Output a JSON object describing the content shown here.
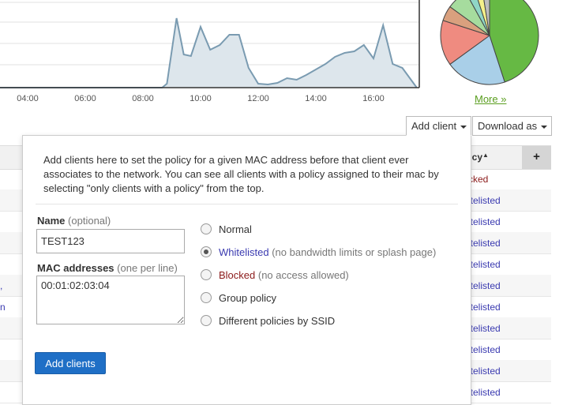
{
  "usage_chart": {
    "x_ticks": [
      "04:00",
      "06:00",
      "08:00",
      "10:00",
      "12:00",
      "14:00",
      "16:00"
    ],
    "series": [
      {
        "x": "00:00",
        "y": 0
      },
      {
        "x": "08:40",
        "y": 0
      },
      {
        "x": "08:50",
        "y": 0.05
      },
      {
        "x": "09:10",
        "y": 0.88
      },
      {
        "x": "09:25",
        "y": 0.42
      },
      {
        "x": "09:40",
        "y": 0.4
      },
      {
        "x": "10:00",
        "y": 0.77
      },
      {
        "x": "10:20",
        "y": 0.48
      },
      {
        "x": "10:40",
        "y": 0.54
      },
      {
        "x": "11:00",
        "y": 0.67
      },
      {
        "x": "11:20",
        "y": 0.67
      },
      {
        "x": "11:40",
        "y": 0.25
      },
      {
        "x": "12:00",
        "y": 0.05
      },
      {
        "x": "12:20",
        "y": 0.04
      },
      {
        "x": "12:40",
        "y": 0.06
      },
      {
        "x": "13:00",
        "y": 0.12
      },
      {
        "x": "13:20",
        "y": 0.1
      },
      {
        "x": "13:40",
        "y": 0.16
      },
      {
        "x": "14:00",
        "y": 0.23
      },
      {
        "x": "14:20",
        "y": 0.3
      },
      {
        "x": "14:40",
        "y": 0.39
      },
      {
        "x": "15:00",
        "y": 0.44
      },
      {
        "x": "15:20",
        "y": 0.46
      },
      {
        "x": "15:40",
        "y": 0.54
      },
      {
        "x": "16:00",
        "y": 0.37
      },
      {
        "x": "16:20",
        "y": 0.79
      },
      {
        "x": "16:40",
        "y": 0.3
      },
      {
        "x": "17:00",
        "y": 0.25
      },
      {
        "x": "17:30",
        "y": 0
      }
    ]
  },
  "pie": {
    "more_label": "More »",
    "slices": [
      {
        "value": 0.45,
        "color": "#66b944"
      },
      {
        "value": 0.2,
        "color": "#a9cfe8"
      },
      {
        "value": 0.15,
        "color": "#ef8b80"
      },
      {
        "value": 0.05,
        "color": "#d9a07e"
      },
      {
        "value": 0.07,
        "color": "#a6dc9e"
      },
      {
        "value": 0.03,
        "color": "#8fd6c6"
      },
      {
        "value": 0.025,
        "color": "#f5f08a"
      },
      {
        "value": 0.025,
        "color": "#bdbdbd"
      }
    ]
  },
  "toolbar": {
    "add_client_label": "Add client",
    "download_label": "Download as"
  },
  "table": {
    "policy_header": "licy",
    "rows": [
      {
        "policy": "cked",
        "status": "blocked"
      },
      {
        "policy": "itelisted",
        "status": "whitelisted"
      },
      {
        "policy": "itelisted",
        "status": "whitelisted"
      },
      {
        "policy": "itelisted",
        "status": "whitelisted"
      },
      {
        "policy": "itelisted",
        "status": "whitelisted"
      },
      {
        "policy": "itelisted",
        "status": "whitelisted"
      },
      {
        "policy": "itelisted",
        "status": "whitelisted"
      },
      {
        "policy": "itelisted",
        "status": "whitelisted"
      },
      {
        "policy": "itelisted",
        "status": "whitelisted"
      },
      {
        "policy": "itelisted",
        "status": "whitelisted"
      },
      {
        "policy": "itelisted",
        "status": "whitelisted"
      }
    ],
    "left_fragments": {
      "5": ",",
      "6": "n"
    }
  },
  "popover": {
    "intro": "Add clients here to set the policy for a given MAC address before that client ever associates to the network. You can see all clients with a policy assigned to their mac by selecting \"only clients with a policy\" from the top.",
    "name_label": "Name",
    "name_optional": "(optional)",
    "name_value": "TEST123",
    "mac_label": "MAC addresses",
    "mac_note": "(one per line)",
    "mac_value": "00:01:02:03:04",
    "policies": {
      "normal": "Normal",
      "whitelisted": "Whitelisted",
      "whitelisted_note": "(no bandwidth limits or splash page)",
      "blocked": "Blocked",
      "blocked_note": "(no access allowed)",
      "group": "Group policy",
      "ssid": "Different policies by SSID"
    },
    "selected_policy": "whitelisted",
    "submit_label": "Add clients"
  }
}
